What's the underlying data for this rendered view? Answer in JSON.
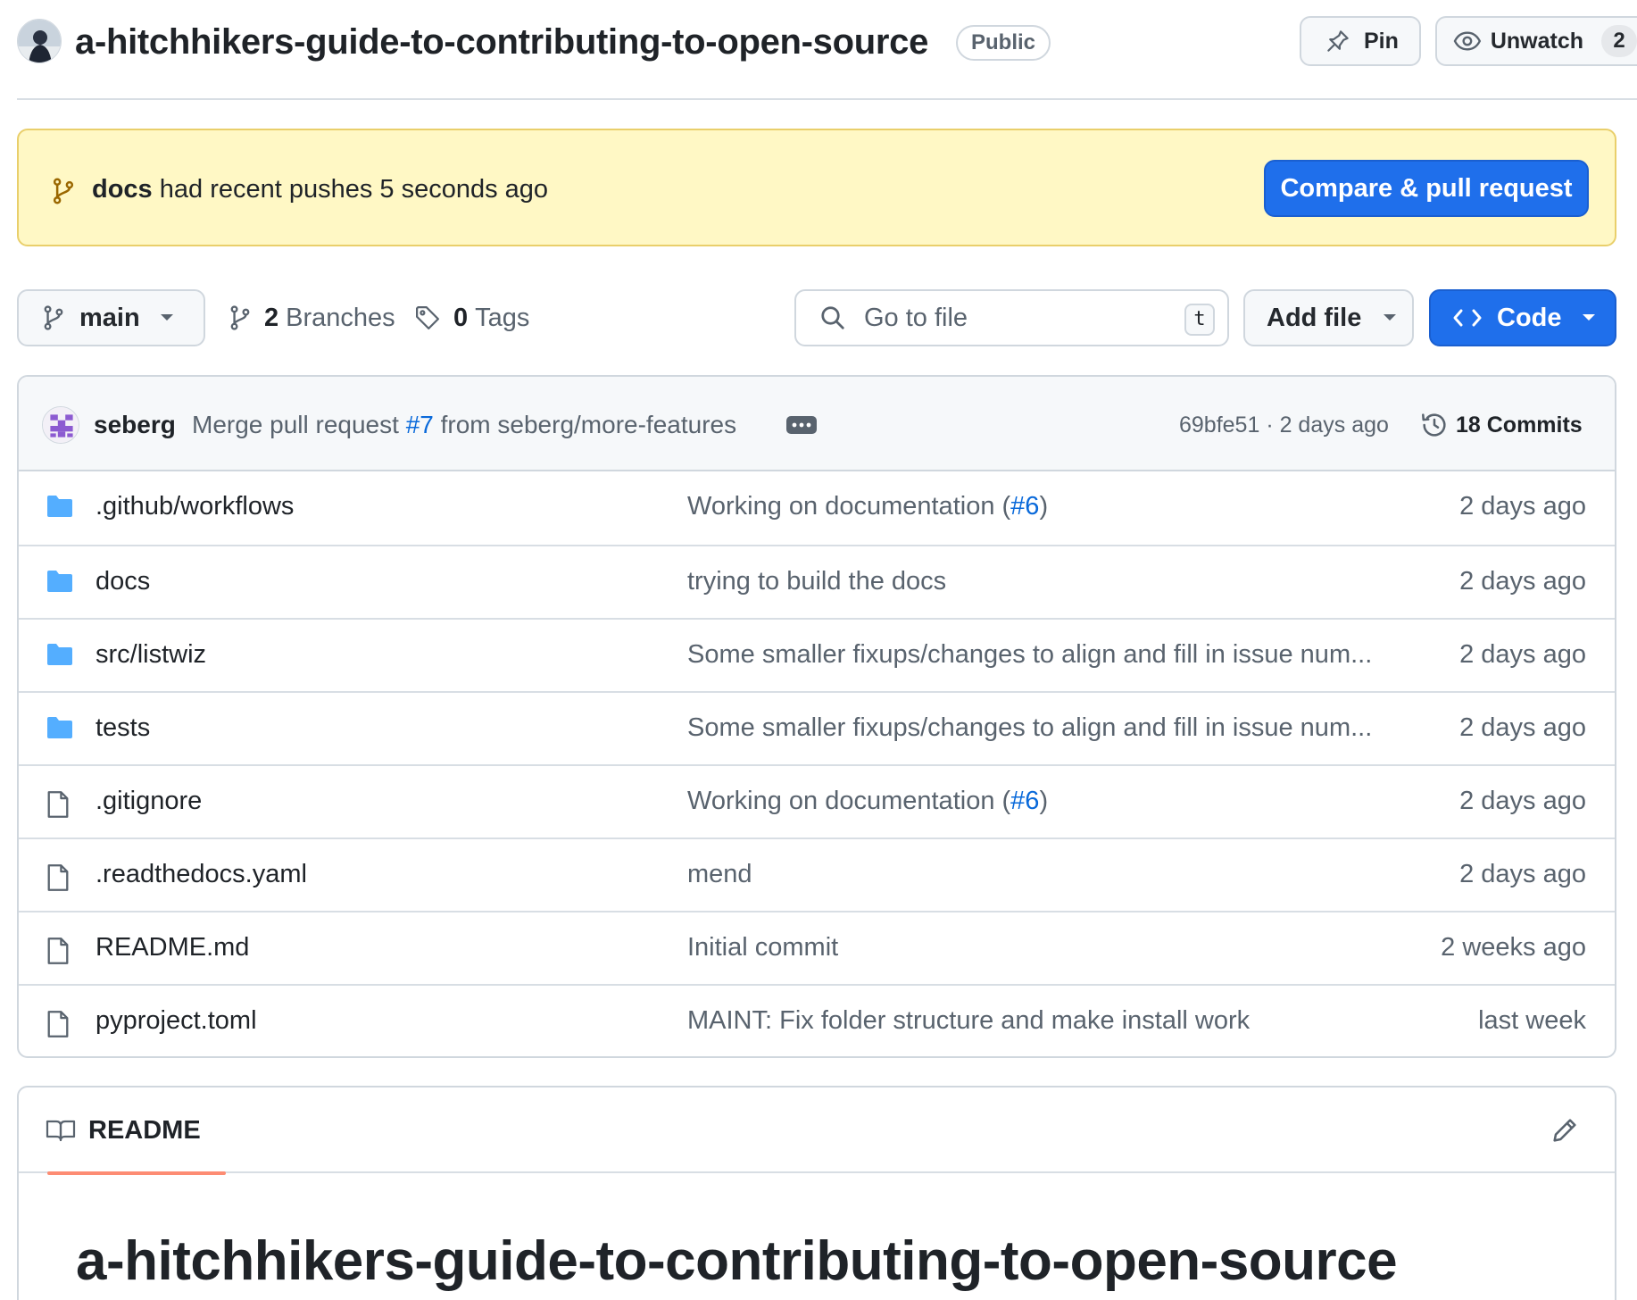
{
  "header": {
    "repo_name": "a-hitchhikers-guide-to-contributing-to-open-source",
    "visibility": "Public",
    "pin_label": "Pin",
    "unwatch_label": "Unwatch",
    "watch_count": "2"
  },
  "push_banner": {
    "branch": "docs",
    "text": "had recent pushes 5 seconds ago",
    "compare_label": "Compare & pull request"
  },
  "toolbar": {
    "branch": "main",
    "branches_count": "2",
    "branches_label": "Branches",
    "tags_count": "0",
    "tags_label": "Tags",
    "goto_placeholder": "Go to file",
    "goto_shortcut": "t",
    "add_file_label": "Add file",
    "code_label": "Code"
  },
  "latest_commit": {
    "author": "seberg",
    "message_prefix": "Merge pull request",
    "pr_number": "#7",
    "message_suffix": "from seberg/more-features",
    "hash_and_time": "69bfe51 · 2 days ago",
    "commits_label": "18 Commits"
  },
  "files": [
    {
      "name": ".github/workflows",
      "type": "folder",
      "message": "Working on documentation (",
      "pr": "#6",
      "message_end": ")",
      "date": "2 days ago"
    },
    {
      "name": "docs",
      "type": "folder",
      "message": "trying to build the docs",
      "pr": "",
      "message_end": "",
      "date": "2 days ago"
    },
    {
      "name": "src/listwiz",
      "type": "folder",
      "message": "Some smaller fixups/changes to align and fill in issue num...",
      "pr": "",
      "message_end": "",
      "date": "2 days ago"
    },
    {
      "name": "tests",
      "type": "folder",
      "message": "Some smaller fixups/changes to align and fill in issue num...",
      "pr": "",
      "message_end": "",
      "date": "2 days ago"
    },
    {
      "name": ".gitignore",
      "type": "file",
      "message": "Working on documentation (",
      "pr": "#6",
      "message_end": ")",
      "date": "2 days ago"
    },
    {
      "name": ".readthedocs.yaml",
      "type": "file",
      "message": "mend",
      "pr": "",
      "message_end": "",
      "date": "2 days ago"
    },
    {
      "name": "README.md",
      "type": "file",
      "message": "Initial commit",
      "pr": "",
      "message_end": "",
      "date": "2 weeks ago"
    },
    {
      "name": "pyproject.toml",
      "type": "file",
      "message": "MAINT: Fix folder structure and make install work",
      "pr": "",
      "message_end": "",
      "date": "last week"
    }
  ],
  "readme": {
    "tab_label": "README",
    "title": "a-hitchhikers-guide-to-contributing-to-open-source"
  },
  "colors": {
    "accent_blue": "#1f6feb",
    "link_blue": "#0969da",
    "banner_bg": "#fff8c5",
    "folder_blue": "#54aeff",
    "tab_underline": "#fd8c73"
  },
  "icons": {
    "folder": "folder-icon",
    "file": "file-icon"
  }
}
